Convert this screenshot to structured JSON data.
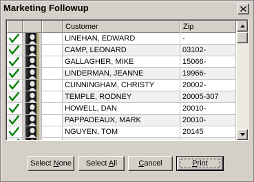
{
  "window": {
    "title": "Marketing Followup"
  },
  "grid": {
    "columns": [
      {
        "label": ""
      },
      {
        "label": ""
      },
      {
        "label": ""
      },
      {
        "label": "Customer"
      },
      {
        "label": "Zip"
      }
    ],
    "rows": [
      {
        "checked": true,
        "customer": "LINEHAN, EDWARD",
        "zip": "-"
      },
      {
        "checked": true,
        "customer": "CAMP, LEONARD",
        "zip": "03102-"
      },
      {
        "checked": true,
        "customer": "GALLAGHER, MIKE",
        "zip": "15066-"
      },
      {
        "checked": true,
        "customer": "LINDERMAN,  JEANNE",
        "zip": "19966-"
      },
      {
        "checked": true,
        "customer": "CUNNINGHAM, CHRISTY",
        "zip": "20002-"
      },
      {
        "checked": true,
        "customer": "TEMPLE, RODNEY",
        "zip": "20005-307"
      },
      {
        "checked": true,
        "customer": "HOWELL,  DAN",
        "zip": "20010-"
      },
      {
        "checked": true,
        "customer": "PAPPADEAUX,  MARK",
        "zip": "20010-"
      },
      {
        "checked": true,
        "customer": "NGUYEN, TOM",
        "zip": "20145"
      },
      {
        "checked": true,
        "customer": "",
        "zip": ""
      }
    ]
  },
  "buttons": {
    "select_none": "Select None",
    "select_all": "Select All",
    "cancel": "Cancel",
    "print": "Print"
  },
  "icons": {
    "close": "close-icon",
    "check": "checkmark-icon",
    "person": "person-silhouette-icon",
    "scroll_up": "scroll-up-arrow-icon",
    "scroll_down": "scroll-down-arrow-icon"
  },
  "colors": {
    "face": "#d4d0c8",
    "check": "#008000",
    "grid_line": "#c0c0c0"
  }
}
